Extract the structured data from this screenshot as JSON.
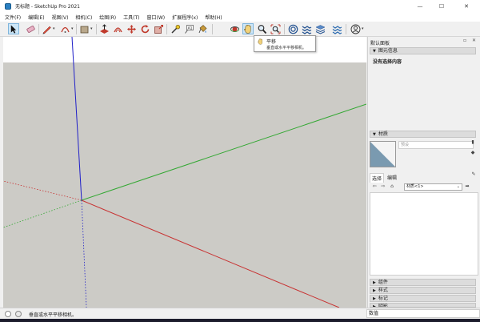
{
  "window": {
    "title": "无标题 - SketchUp Pro 2021",
    "controls": {
      "minimize": "—",
      "maximize": "☐",
      "close": "✕"
    }
  },
  "menubar": {
    "items": [
      "文件(F)",
      "编辑(E)",
      "视图(V)",
      "相机(C)",
      "绘图(R)",
      "工具(T)",
      "窗口(W)",
      "扩展程序(x)",
      "帮助(H)"
    ]
  },
  "toolbar": {
    "tools": [
      "select-tool",
      "eraser-tool",
      "line-tool",
      "arc-tool",
      "rectangle-tool",
      "push-pull-tool",
      "offset-tool",
      "move-tool",
      "rotate-tool",
      "scale-tool",
      "tape-measure-tool",
      "text-tool",
      "paint-bucket-tool",
      "orbit-tool",
      "pan-tool",
      "zoom-tool",
      "zoom-extents-tool",
      "3d-warehouse-tool",
      "extension-warehouse-tool",
      "layout-tool",
      "extension-manager-tool",
      "account-tool"
    ]
  },
  "tooltip": {
    "title": "平移",
    "description": "垂直或水平平移相机。"
  },
  "tray": {
    "title": "默认面板",
    "entity_info": {
      "header": "图元信息",
      "empty_text": "没有选择内容"
    },
    "materials": {
      "header": "材质",
      "name_placeholder": "预设",
      "tabs": [
        "选择",
        "编辑"
      ],
      "library": "材质<1>"
    },
    "collapsed_panels": [
      "组件",
      "样式",
      "标记",
      "阴影"
    ]
  },
  "statusbar": {
    "hint": "垂直或水平平移相机。",
    "measurements_label": "数值"
  },
  "colors": {
    "axis_blue": "#2020c8",
    "axis_green": "#33a833",
    "axis_red": "#c83232",
    "sky": "#ffffff",
    "ground": "#cccbc6"
  }
}
